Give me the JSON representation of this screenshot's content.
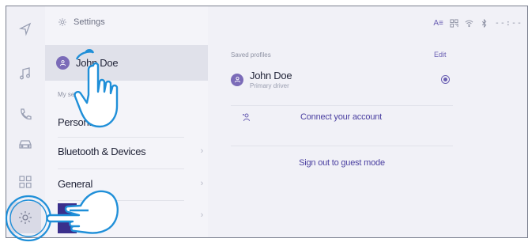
{
  "rail": {
    "icons": [
      "navigation-icon",
      "music-icon",
      "phone-icon",
      "car-icon",
      "apps-icon",
      "settings-icon"
    ]
  },
  "menu": {
    "header": "Settings",
    "profile_name": "John Doe",
    "section_label": "My setti",
    "items": [
      {
        "label": "Persona"
      },
      {
        "label": "Bluetooth & Devices"
      },
      {
        "label": "General"
      }
    ]
  },
  "status": {
    "time": "--:--"
  },
  "content": {
    "saved_profiles_label": "Saved profiles",
    "edit_label": "Edit",
    "driver_name": "John Doe",
    "driver_role": "Primary driver",
    "connect_label": "Connect your account",
    "guest_label": "Sign out to guest mode"
  },
  "colors": {
    "accent": "#6a5fb3",
    "avatar": "#7b6bb8",
    "selected_row": "#e0e1ea",
    "highlight_circle": "#1f8fd8"
  }
}
